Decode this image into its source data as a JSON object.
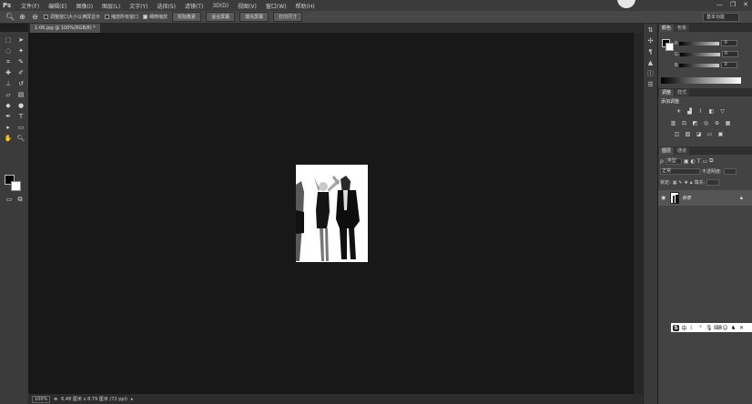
{
  "app": {
    "logo": "Ps"
  },
  "menu": [
    "文件(F)",
    "编辑(E)",
    "图像(I)",
    "图层(L)",
    "文字(Y)",
    "选择(S)",
    "滤镜(T)",
    "3D(D)",
    "视图(V)",
    "窗口(W)",
    "帮助(H)"
  ],
  "window_controls": {
    "minimize": "—",
    "restore": "❐",
    "close": "✕"
  },
  "options": {
    "tool_icon": "zoom-icon",
    "checks": [
      {
        "label": "调整窗口大小以满屏显示",
        "checked": false
      },
      {
        "label": "缩放所有窗口",
        "checked": false
      },
      {
        "label": "细微缩放",
        "checked": true
      }
    ],
    "buttons": [
      "实际像素",
      "适合屏幕",
      "填充屏幕",
      "打印尺寸"
    ],
    "workspace": "基本功能"
  },
  "document": {
    "tab_title": "1-06.jpg @ 100%(RGB/8) *",
    "zoom": "100%",
    "doc_info": "6.48 厘米 x 8.79 厘米 (72 ppi)"
  },
  "panels": {
    "color": {
      "tabs": [
        "颜色",
        "色板"
      ],
      "sliders": [
        {
          "label": "R",
          "value": "0"
        },
        {
          "label": "G",
          "value": "0"
        },
        {
          "label": "B",
          "value": "0"
        }
      ]
    },
    "adjustments": {
      "tabs": [
        "调整",
        "样式"
      ],
      "title": "添加调整"
    },
    "layers": {
      "tabs": [
        "图层",
        "通道"
      ],
      "filter": "类型",
      "blend_mode": "正常",
      "opacity_label": "不透明度:",
      "lock_label": "锁定:",
      "fill_label": "填充:",
      "layer_name": "背景"
    }
  },
  "ime": {
    "logo": "S"
  }
}
